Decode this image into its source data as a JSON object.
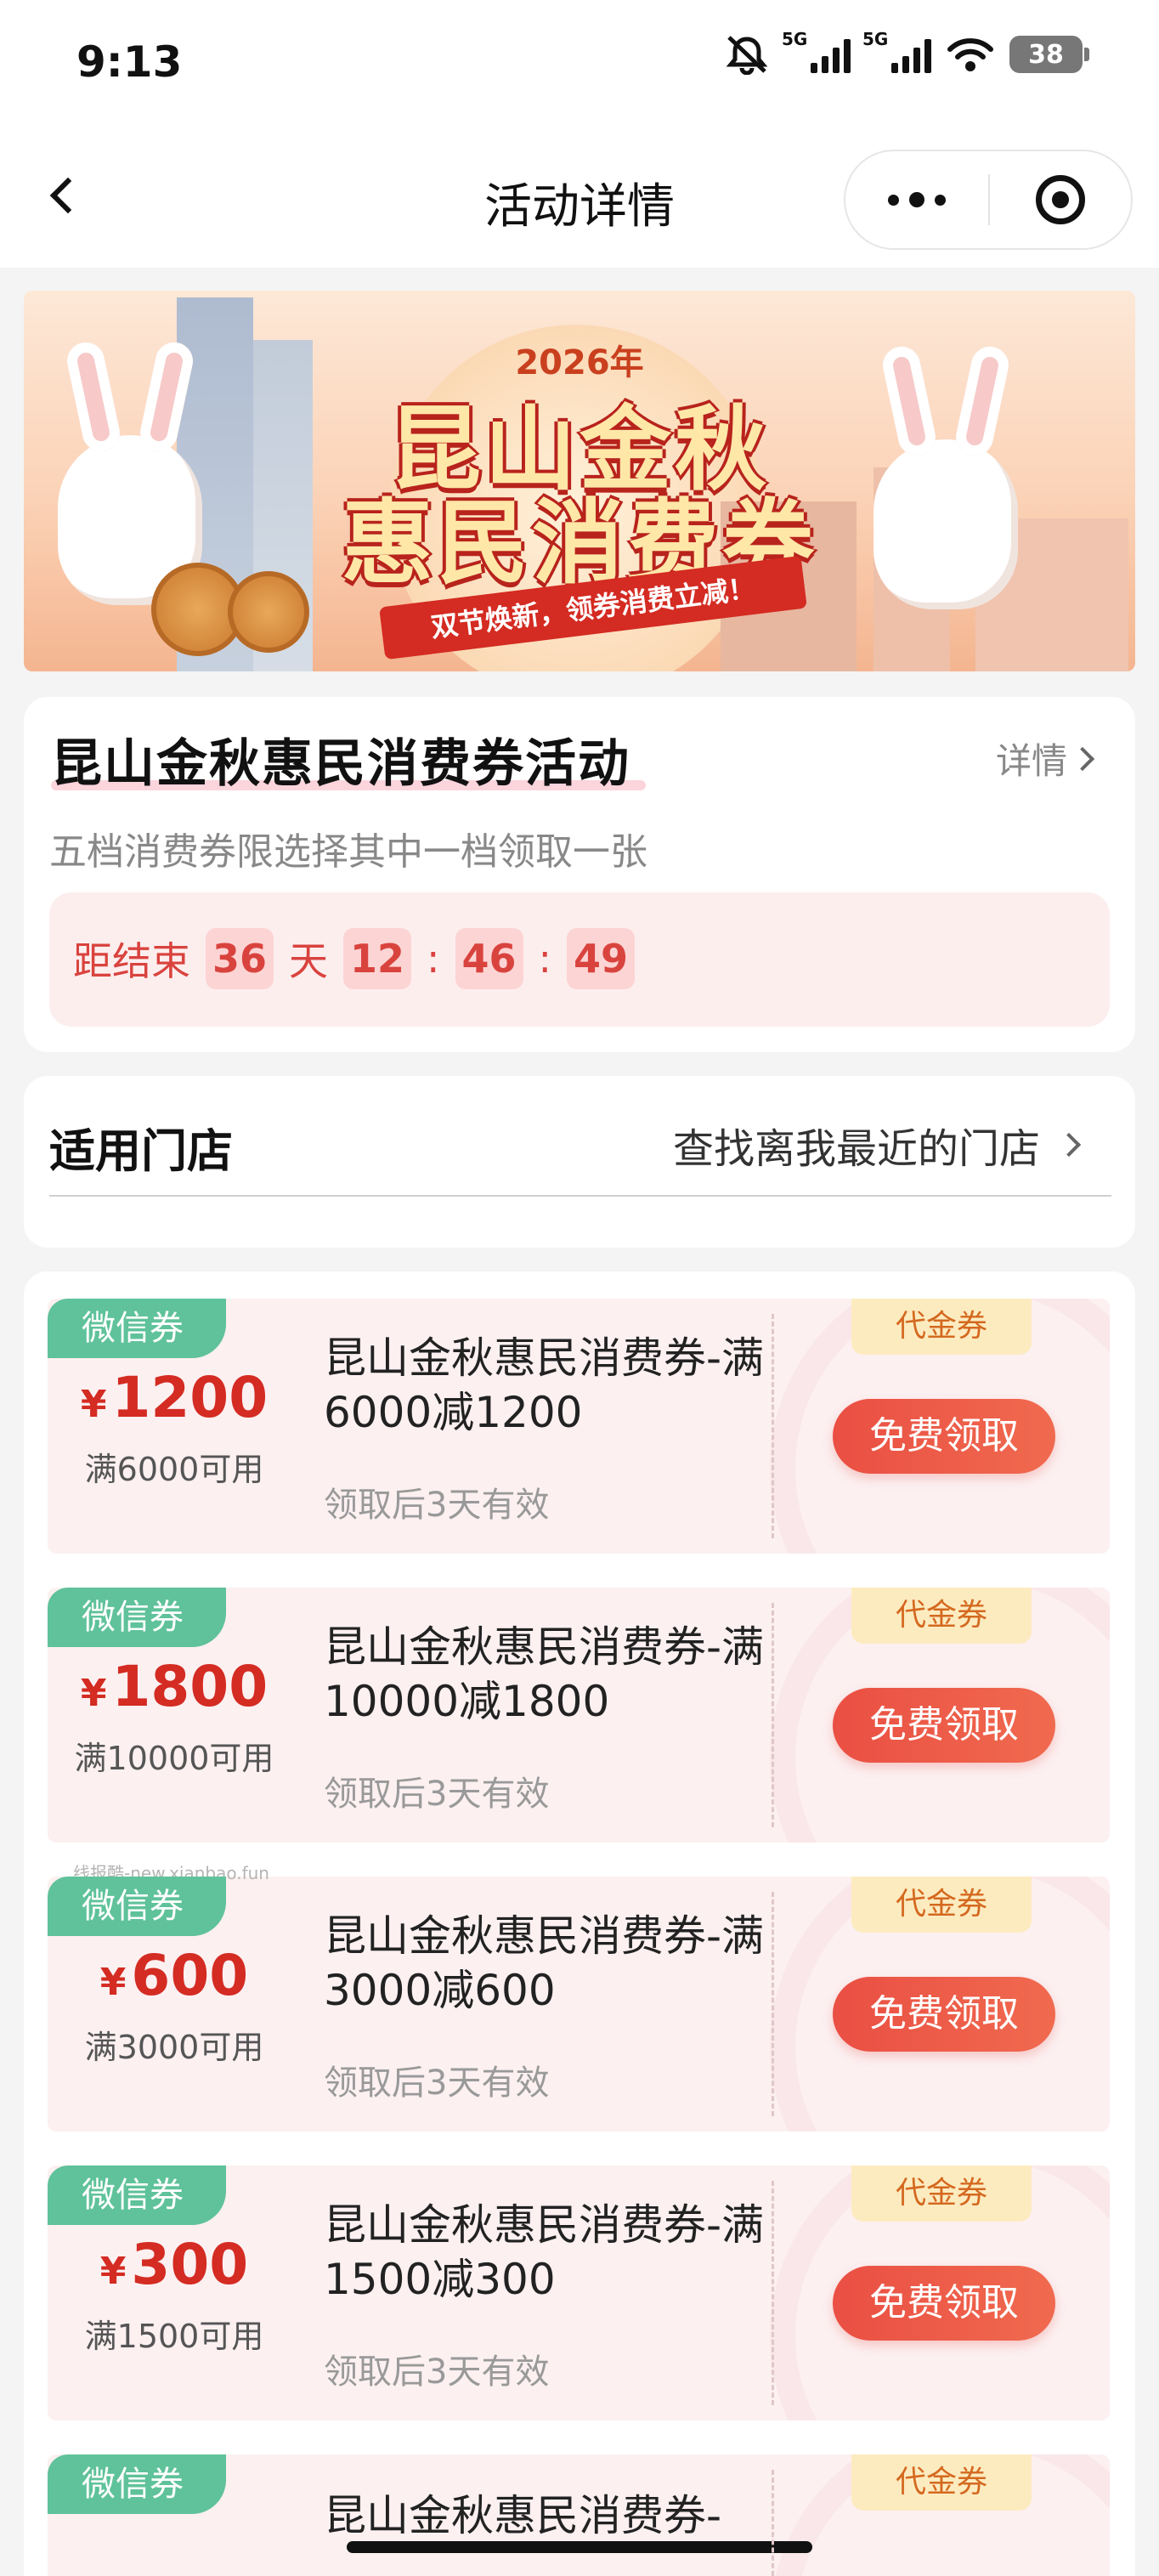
{
  "status_bar": {
    "time": "9:13",
    "network1": "5G",
    "network2": "5G",
    "battery": "38"
  },
  "nav": {
    "title": "活动详情"
  },
  "banner": {
    "year": "2026年",
    "title_line1": "昆山金秋",
    "title_line2": "惠民消费券",
    "ribbon": "双节焕新，领券消费立减！"
  },
  "activity": {
    "title": "昆山金秋惠民消费券活动",
    "detail_link": "详情",
    "subtitle": "五档消费券限选择其中一档领取一张",
    "countdown": {
      "label": "距结束",
      "days": "36",
      "day_unit": "天",
      "hours": "12",
      "minutes": "46",
      "seconds": "49",
      "sep": ":"
    }
  },
  "stores": {
    "title": "适用门店",
    "link": "查找离我最近的门店"
  },
  "coupons": [
    {
      "tag": "微信券",
      "currency": "¥",
      "amount": "1200",
      "condition": "满6000可用",
      "name": "昆山金秋惠民消费券-满6000减1200",
      "validity": "领取后3天有效",
      "type": "代金券",
      "button": "免费领取"
    },
    {
      "tag": "微信券",
      "currency": "¥",
      "amount": "1800",
      "condition": "满10000可用",
      "name": "昆山金秋惠民消费券-满10000减1800",
      "validity": "领取后3天有效",
      "type": "代金券",
      "button": "免费领取"
    },
    {
      "tag": "微信券",
      "currency": "¥",
      "amount": "600",
      "condition": "满3000可用",
      "name": "昆山金秋惠民消费券-满3000减600",
      "validity": "领取后3天有效",
      "type": "代金券",
      "button": "免费领取"
    },
    {
      "tag": "微信券",
      "currency": "¥",
      "amount": "300",
      "condition": "满1500可用",
      "name": "昆山金秋惠民消费券-满1500减300",
      "validity": "领取后3天有效",
      "type": "代金券",
      "button": "免费领取"
    },
    {
      "tag": "微信券",
      "currency": "",
      "amount": "",
      "condition": "",
      "name": "昆山金秋惠民消费券-",
      "validity": "",
      "type": "代金券",
      "button": ""
    }
  ],
  "watermark": "线报酷-new.xianbao.fun",
  "colors": {
    "accent_red": "#d42b22",
    "button_red": "#ea4f43",
    "wechat_green": "#5fc29a",
    "countdown_bg": "#fdeeee"
  }
}
